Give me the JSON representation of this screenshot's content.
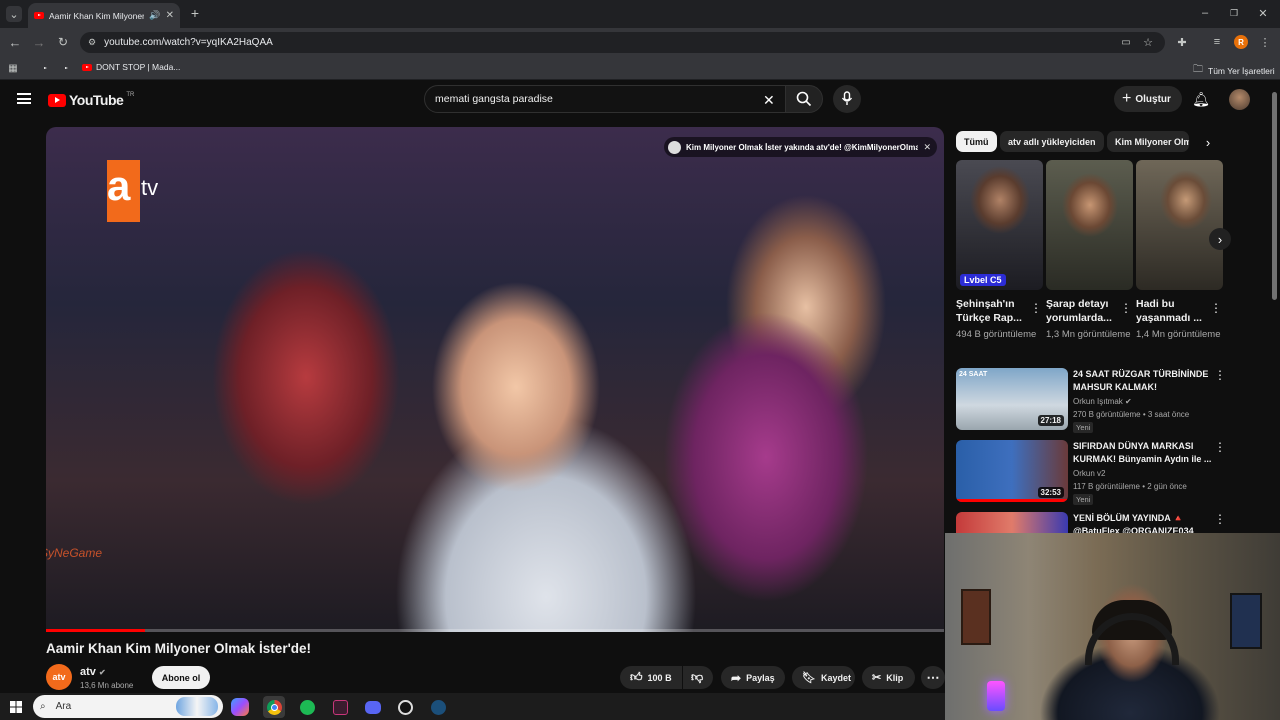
{
  "browser": {
    "tab_title": "Aamir Khan Kim Milyoner Olmak İster'de!",
    "url": "youtube.com/watch?v=yqIKA2HaQAA",
    "bookmark_dont_stop": "DONT STOP | Mada...",
    "bookmarks_all": "Tüm Yer İşaretleri",
    "profile_initial": "R"
  },
  "youtube": {
    "logo_text": "YouTube",
    "region": "TR",
    "search_query": "memati gangsta paradise",
    "create_label": "Oluştur"
  },
  "video": {
    "channel_promo": "Kim Milyoner Olmak İster yakında atv'de! @KimMilyonerOlmakI...",
    "watermark": "SyNeGame",
    "overlay_tv": "tv",
    "overlay_a": "a",
    "title": "Aamir Khan Kim Milyoner Olmak İster'de!",
    "progress_fraction": 0.11,
    "channel_name": "atv",
    "channel_avatar_text": "atv",
    "subscribers": "13,6 Mn abone",
    "subscribe_label": "Abone ol",
    "likes": "100 B",
    "share_label": "Paylaş",
    "save_label": "Kaydet",
    "clip_label": "Klip"
  },
  "sidebar": {
    "chips": [
      "Tümü",
      "atv adlı yükleyiciden",
      "Kim Milyoner Olm"
    ],
    "shorts": [
      {
        "title": "Şehinşah'ın Türkçe Rap...",
        "views": "494 B görüntüleme",
        "overlay": "Lvbel C5"
      },
      {
        "title": "Şarap detayı yorumlarda...",
        "views": "1,3 Mn görüntüleme"
      },
      {
        "title": "Hadi bu yaşanmadı ...",
        "views": "1,4 Mn görüntüleme"
      }
    ],
    "recs": [
      {
        "title": "24 SAAT RÜZGAR TÜRBİNİNDE MAHSUR KALMAK!",
        "channel": "Orkun Işıtmak",
        "meta": "270 B görüntüleme • 3 saat önce",
        "badge": "Yeni",
        "duration": "27:18",
        "thumb_label": "24 SAAT"
      },
      {
        "title": "SIFIRDAN DÜNYA MARKASI KURMAK! Bünyamin Aydın ile ...",
        "channel": "Orkun v2",
        "meta": "117 B görüntüleme • 2 gün önce",
        "badge": "Yeni",
        "duration": "32:53"
      },
      {
        "title": "YENİ BÖLÜM YAYINDA 🔺 @BatuFlex @ORGANIZE034"
      }
    ]
  },
  "taskbar": {
    "search_label": "Ara"
  }
}
